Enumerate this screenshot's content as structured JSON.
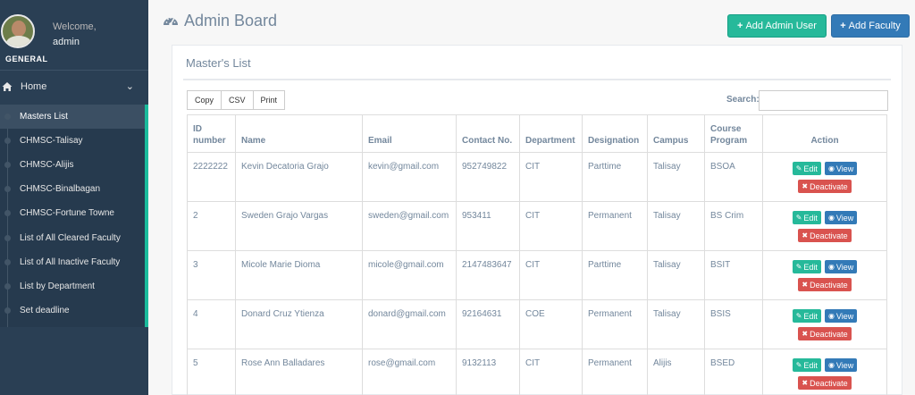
{
  "sidebar": {
    "welcome": "Welcome,",
    "username": "admin",
    "section": "GENERAL",
    "home_label": "Home",
    "items": [
      {
        "label": "Masters List"
      },
      {
        "label": "CHMSC-Talisay"
      },
      {
        "label": "CHMSC-Alijis"
      },
      {
        "label": "CHMSC-Binalbagan"
      },
      {
        "label": "CHMSC-Fortune Towne"
      },
      {
        "label": "List of All Cleared Faculty"
      },
      {
        "label": "List of All Inactive Faculty"
      },
      {
        "label": "List by Department"
      },
      {
        "label": "Set deadline"
      }
    ]
  },
  "header": {
    "title": "Admin Board",
    "add_admin_label": "Add Admin User",
    "add_faculty_label": "Add Faculty"
  },
  "panel": {
    "title": "Master's List",
    "buttons": {
      "copy": "Copy",
      "csv": "CSV",
      "print": "Print"
    },
    "search_label": "Search:",
    "search_value": ""
  },
  "table": {
    "headers": {
      "id": "ID number",
      "name": "Name",
      "email": "Email",
      "contact": "Contact No.",
      "department": "Department",
      "designation": "Designation",
      "campus": "Campus",
      "course": "Course Program",
      "action": "Action"
    },
    "actions": {
      "edit": "Edit",
      "view": "View",
      "deactivate": "Deactivate"
    },
    "rows": [
      {
        "id": "2222222",
        "name": "Kevin Decatoria Grajo",
        "email": "kevin@gmail.com",
        "contact": "952749822",
        "department": "CIT",
        "designation": "Parttime",
        "campus": "Talisay",
        "course": "BSOA"
      },
      {
        "id": "2",
        "name": "Sweden Grajo Vargas",
        "email": "sweden@gmail.com",
        "contact": "953411",
        "department": "CIT",
        "designation": "Permanent",
        "campus": "Talisay",
        "course": "BS Crim"
      },
      {
        "id": "3",
        "name": "Micole Marie Dioma",
        "email": "micole@gmail.com",
        "contact": "2147483647",
        "department": "CIT",
        "designation": "Parttime",
        "campus": "Talisay",
        "course": "BSIT"
      },
      {
        "id": "4",
        "name": "Donard Cruz Ytienza",
        "email": "donard@gmail.com",
        "contact": "92164631",
        "department": "COE",
        "designation": "Permanent",
        "campus": "Talisay",
        "course": "BSIS"
      },
      {
        "id": "5",
        "name": "Rose Ann Balladares",
        "email": "rose@gmail.com",
        "contact": "9132113",
        "department": "CIT",
        "designation": "Permanent",
        "campus": "Alijis",
        "course": "BSED"
      }
    ]
  },
  "colors": {
    "sidebar_bg": "#2A3F54",
    "accent_green": "#26B99A",
    "accent_blue": "#337AB7",
    "danger_red": "#D9534F"
  }
}
